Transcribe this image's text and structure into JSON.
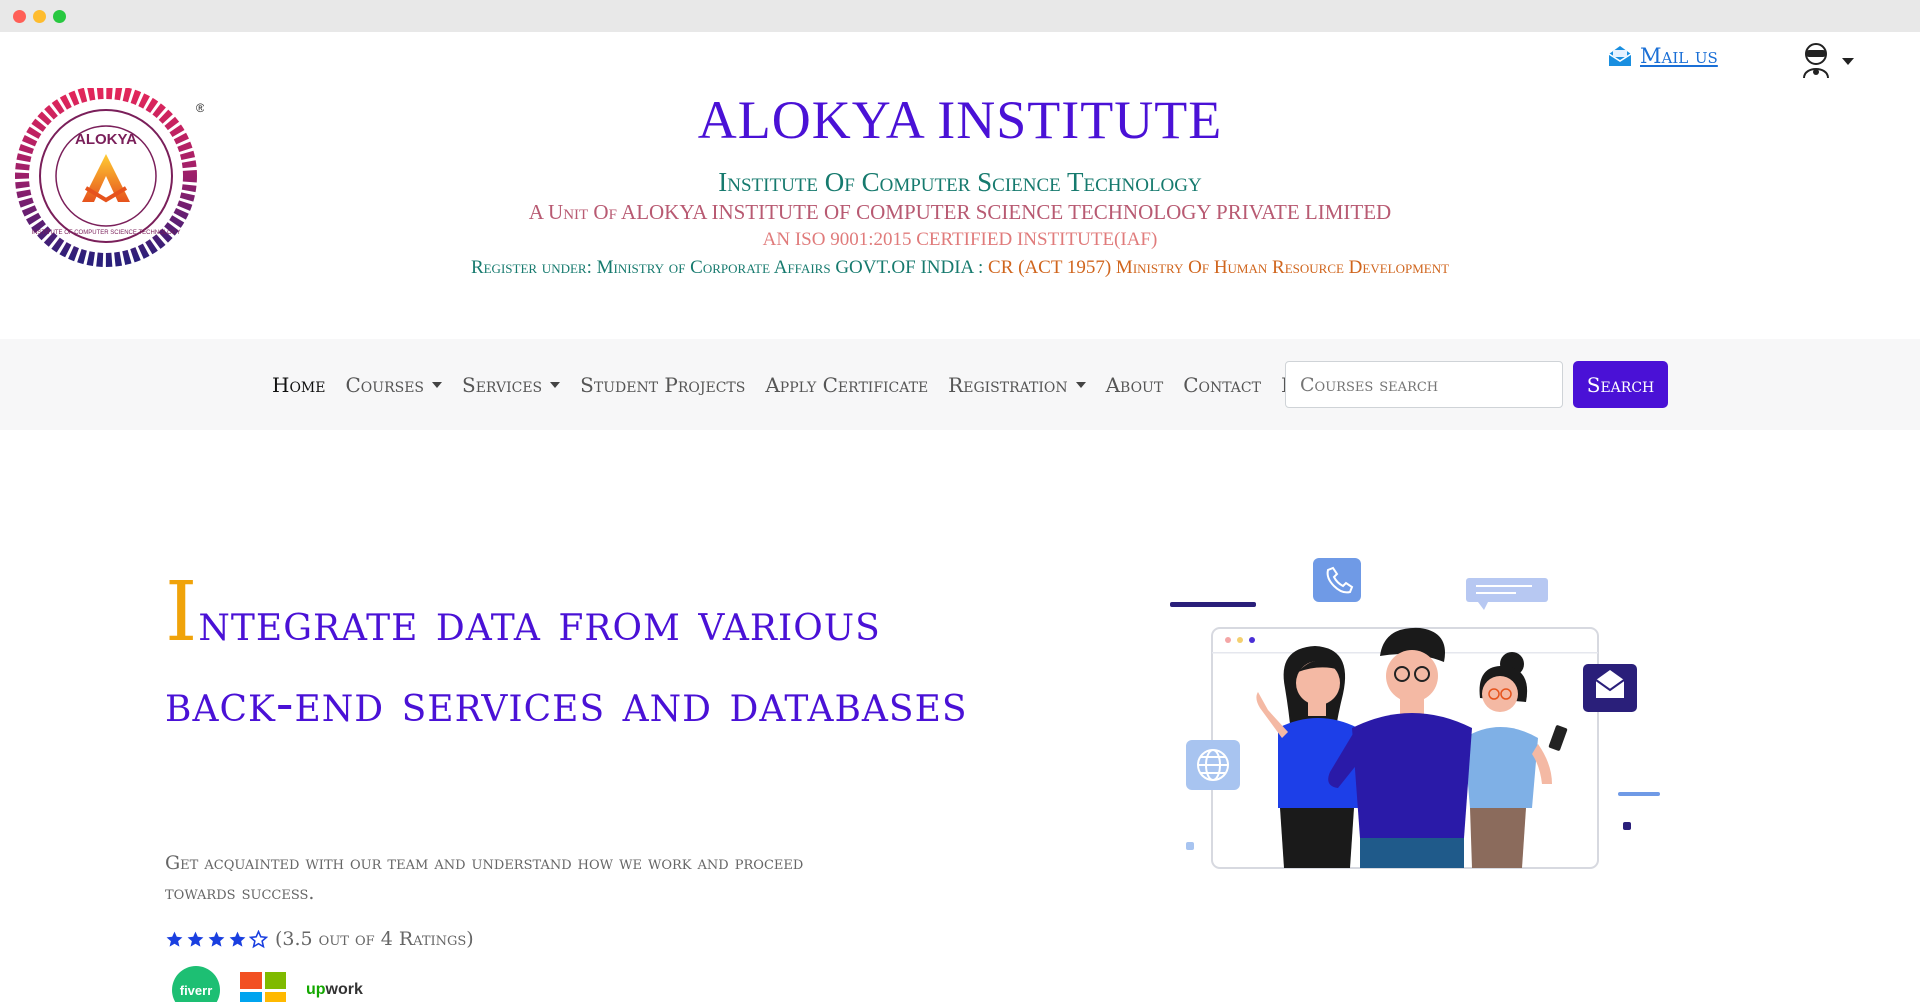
{
  "header": {
    "mail_label": "Mail us",
    "institute_title": "ALOKYA INSTITUTE",
    "institute_subtitle": "Institute Of Computer Science Technology",
    "unit_line": "A Unit Of ALOKYA INSTITUTE OF COMPUTER SCIENCE TECHNOLOGY PRIVATE LIMITED",
    "iso_line": "AN ISO 9001:2015 CERTIFIED INSTITUTE(IAF)",
    "register_part1": "Register under: Ministry of Corporate Affairs GOVT.OF INDIA : ",
    "register_part2": "CR (ACT 1957) Ministry Of Human Resource Development",
    "logo_text": "ALOKYA",
    "logo_ring_text": "INSTITUTE OF COMPUTER SCIENCE TECHNOLOGY",
    "logo_trademark": "®"
  },
  "nav": {
    "items": [
      {
        "label": "Home",
        "active": true,
        "dropdown": false
      },
      {
        "label": "Courses",
        "active": false,
        "dropdown": true
      },
      {
        "label": "Services",
        "active": false,
        "dropdown": true
      },
      {
        "label": "Student Projects",
        "active": false,
        "dropdown": false
      },
      {
        "label": "Apply Certificate",
        "active": false,
        "dropdown": false
      },
      {
        "label": "Registration",
        "active": false,
        "dropdown": true
      },
      {
        "label": "About",
        "active": false,
        "dropdown": false
      },
      {
        "label": "Contact",
        "active": false,
        "dropdown": false
      },
      {
        "label": "Blog",
        "active": false,
        "dropdown": false
      }
    ],
    "search_placeholder": "Courses search",
    "search_button": "Search"
  },
  "hero": {
    "title_initial": "I",
    "title_rest": "ntegrate data from various back-end services and databases",
    "description": "Get acquainted with our team and understand how we work and proceed towards success.",
    "rating_text": "(3.5 out of 4 Ratings)",
    "rating_value": 3.5,
    "rating_max": 4,
    "stars_shown": 5,
    "partners": [
      "fiverr",
      "microsoft",
      "upwork"
    ],
    "fiverr_label": "fiverr",
    "upwork_label_a": "up",
    "upwork_label_b": "work"
  },
  "colors": {
    "brand_purple": "#4a11d6",
    "accent_orange": "#f0a30a",
    "teal": "#167a6e",
    "star_blue": "#1a3fe0"
  },
  "icons": [
    "mail-icon",
    "user-avatar-icon",
    "caret-down-icon",
    "star-icon",
    "phone-icon",
    "chat-icon",
    "envelope-icon",
    "globe-icon"
  ]
}
